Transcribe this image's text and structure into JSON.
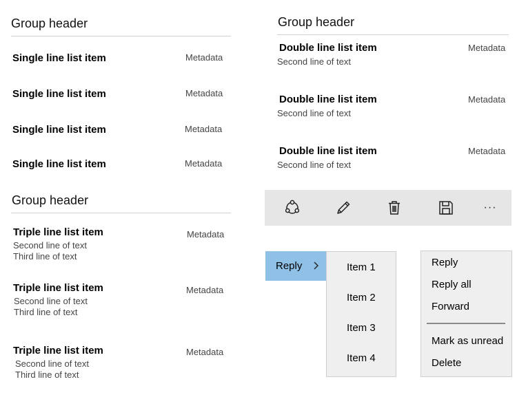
{
  "left_group_1": {
    "header": "Group header",
    "items": [
      {
        "title": "Single line list item",
        "meta": "Metadata"
      },
      {
        "title": "Single line list item",
        "meta": "Metadata"
      },
      {
        "title": "Single line list item",
        "meta": "Metadata"
      },
      {
        "title": "Single line list item",
        "meta": "Metadata"
      }
    ]
  },
  "left_group_2": {
    "header": "Group header",
    "items": [
      {
        "title": "Triple line list item",
        "line2": "Second line of text",
        "line3": "Third line of text",
        "meta": "Metadata"
      },
      {
        "title": "Triple line list item",
        "line2": "Second line of text",
        "line3": "Third line of text",
        "meta": "Metadata"
      },
      {
        "title": "Triple line list item",
        "line2": "Second line of text",
        "line3": "Third line of text",
        "meta": "Metadata"
      }
    ]
  },
  "right_group": {
    "header": "Group header",
    "items": [
      {
        "title": "Double line list item",
        "line2": "Second line of text",
        "meta": "Metadata"
      },
      {
        "title": "Double line list item",
        "line2": "Second line of text",
        "meta": "Metadata"
      },
      {
        "title": "Double line list item",
        "line2": "Second line of text",
        "meta": "Metadata"
      }
    ]
  },
  "toolbar": {
    "background": "#e6e6e6",
    "icons": [
      "share-icon",
      "edit-icon",
      "delete-icon",
      "save-icon",
      "more-icon"
    ],
    "more_glyph": "···"
  },
  "reply_menu": {
    "label": "Reply",
    "accent": "#8fc0e6",
    "submenu": [
      "Item 1",
      "Item 2",
      "Item 3",
      "Item 4"
    ]
  },
  "context_menu": {
    "items_top": [
      "Reply",
      "Reply all",
      "Forward"
    ],
    "items_bottom": [
      "Mark as unread",
      "Delete"
    ]
  }
}
